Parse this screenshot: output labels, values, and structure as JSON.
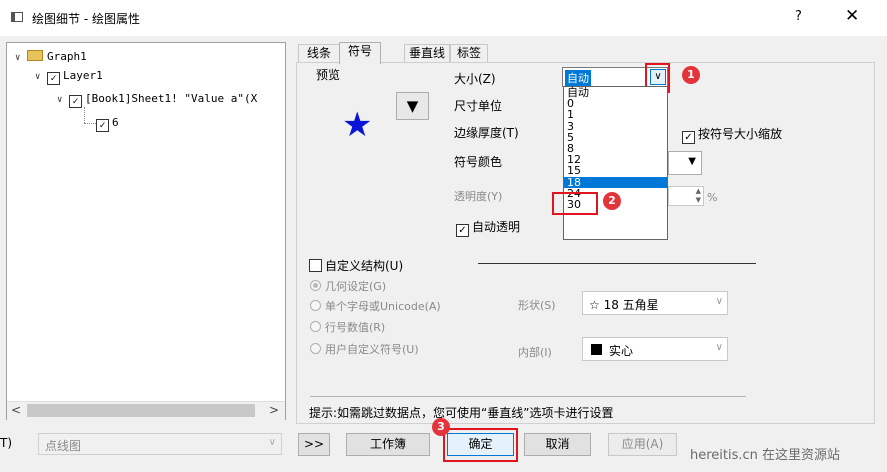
{
  "window": {
    "title": "绘图细节 - 绘图属性",
    "help": "?",
    "close": "✕"
  },
  "tree": {
    "graph": "Graph1",
    "layer": "Layer1",
    "plot": "[Book1]Sheet1! \"Value a\"(X",
    "item": "6"
  },
  "tabs": [
    "线条",
    "符号",
    "垂直线",
    "标签"
  ],
  "symbol": {
    "preview_label": "预览",
    "size_label": "大小(Z)",
    "size_value": "自动",
    "size_options": [
      "自动",
      "0",
      "1",
      "3",
      "5",
      "8",
      "12",
      "15",
      "18",
      "24",
      "30"
    ],
    "size_selected": "18",
    "unit_label": "尺寸单位",
    "edge_label": "边缘厚度(T)",
    "scale_label": "按符号大小缩放",
    "color_label": "符号颜色",
    "transparency_label": "透明度(Y)",
    "percent": "%",
    "auto_transparent": "自动透明",
    "custom_label": "自定义结构(U)",
    "geom": "几何设定(G)",
    "single_char": "单个字母或Unicode(A)",
    "row_number": "行号数值(R)",
    "user_symbol": "用户自定义符号(U)",
    "shape_label": "形状(S)",
    "shape_value": "☆ 18 五角星",
    "interior_label": "内部(I)",
    "interior_value": "实心"
  },
  "hint": "提示:如需跳过数据点，您可使用“垂直线”选项卡进行设置",
  "bottom": {
    "left_label": "T)",
    "plot_type": "点线图",
    "expand": ">>",
    "workbook": "工作簿",
    "ok": "确定",
    "cancel": "取消",
    "apply": "应用(A)"
  },
  "badges": [
    "1",
    "2",
    "3"
  ],
  "watermark": "hereitis.cn 在这里资源站"
}
